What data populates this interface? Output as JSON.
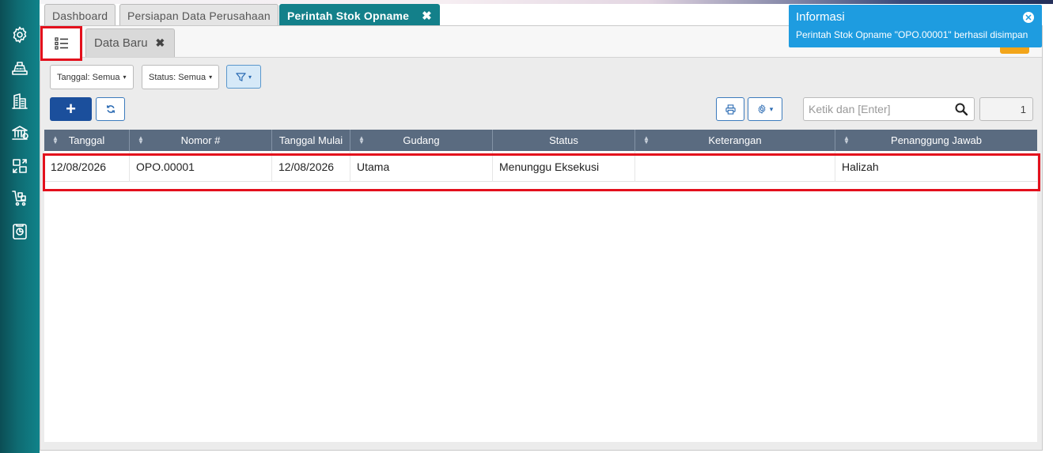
{
  "tabs": [
    {
      "label": "Dashboard"
    },
    {
      "label": "Persiapan Data Perusahaan"
    },
    {
      "label": "Perintah Stok Opname"
    }
  ],
  "subtabs": {
    "data_baru": "Data Baru"
  },
  "filters": {
    "tanggal": "Tanggal: Semua",
    "status": "Status: Semua"
  },
  "search": {
    "placeholder": "Ketik dan [Enter]"
  },
  "page_number": "1",
  "table": {
    "columns": [
      "Tanggal",
      "Nomor #",
      "Tanggal Mulai",
      "Gudang",
      "Status",
      "Keterangan",
      "Penanggung Jawab"
    ],
    "rows": [
      {
        "tanggal": "12/08/2026",
        "nomor": "OPO.00001",
        "tanggal_mulai": "12/08/2026",
        "gudang": "Utama",
        "status": "Menunggu Eksekusi",
        "keterangan": "",
        "penanggung_jawab": "Halizah"
      }
    ]
  },
  "toast": {
    "title": "Informasi",
    "message": "Perintah Stok Opname \"OPO.00001\" berhasil disimpan"
  },
  "colors": {
    "sidebar": "#0f6b72",
    "active_tab": "#13808a",
    "header": "#5a6b80",
    "primary_button": "#1b4f9c",
    "toast": "#1e9ce0",
    "highlight": "#e3101c"
  },
  "sidebar_icons": [
    "gear-icon",
    "cash-register-icon",
    "building-icon",
    "bank-icon",
    "inventory-transfer-icon",
    "cart-icon",
    "report-icon"
  ]
}
